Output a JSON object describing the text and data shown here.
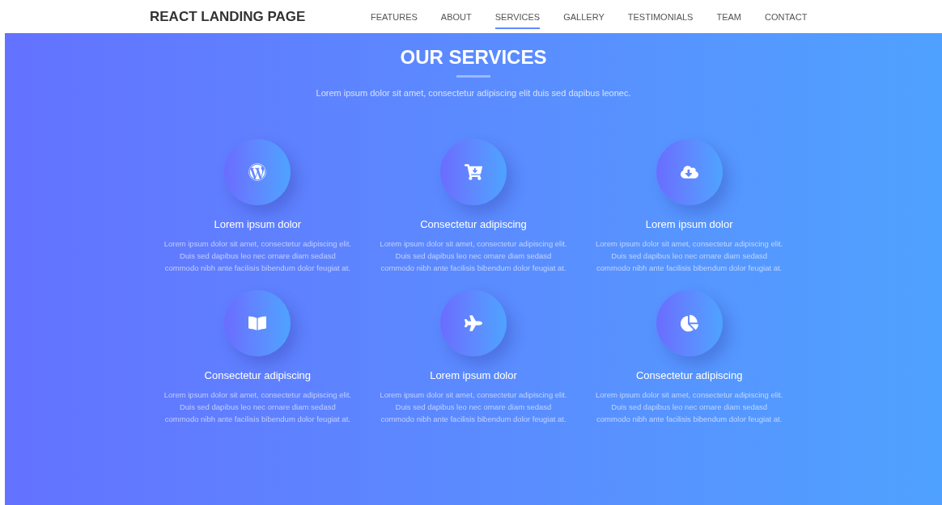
{
  "brand": "REACT LANDING PAGE",
  "nav": [
    {
      "label": "FEATURES",
      "selected": false
    },
    {
      "label": "ABOUT",
      "selected": false
    },
    {
      "label": "SERVICES",
      "selected": true
    },
    {
      "label": "GALLERY",
      "selected": false
    },
    {
      "label": "TESTIMONIALS",
      "selected": false
    },
    {
      "label": "TEAM",
      "selected": false
    },
    {
      "label": "CONTACT",
      "selected": false
    }
  ],
  "section": {
    "title": "OUR SERVICES",
    "subtitle": "Lorem ipsum dolor sit amet, consectetur adipiscing elit duis sed dapibus leonec.",
    "services": [
      {
        "title": "Lorem ipsum dolor",
        "text": "Lorem ipsum dolor sit amet, consectetur adipiscing elit. Duis sed dapibus leo nec ornare diam sedasd commodo nibh ante facilisis bibendum dolor feugiat at."
      },
      {
        "title": "Consectetur adipiscing",
        "text": "Lorem ipsum dolor sit amet, consectetur adipiscing elit. Duis sed dapibus leo nec ornare diam sedasd commodo nibh ante facilisis bibendum dolor feugiat at."
      },
      {
        "title": "Lorem ipsum dolor",
        "text": "Lorem ipsum dolor sit amet, consectetur adipiscing elit. Duis sed dapibus leo nec ornare diam sedasd commodo nibh ante facilisis bibendum dolor feugiat at."
      },
      {
        "title": "Consectetur adipiscing",
        "text": "Lorem ipsum dolor sit amet, consectetur adipiscing elit. Duis sed dapibus leo nec ornare diam sedasd commodo nibh ante facilisis bibendum dolor feugiat at."
      },
      {
        "title": "Lorem ipsum dolor",
        "text": "Lorem ipsum dolor sit amet, consectetur adipiscing elit. Duis sed dapibus leo nec ornare diam sedasd commodo nibh ante facilisis bibendum dolor feugiat at."
      },
      {
        "title": "Consectetur adipiscing",
        "text": "Lorem ipsum dolor sit amet, consectetur adipiscing elit. Duis sed dapibus leo nec ornare diam sedasd commodo nibh ante facilisis bibendum dolor feugiat at."
      }
    ]
  }
}
